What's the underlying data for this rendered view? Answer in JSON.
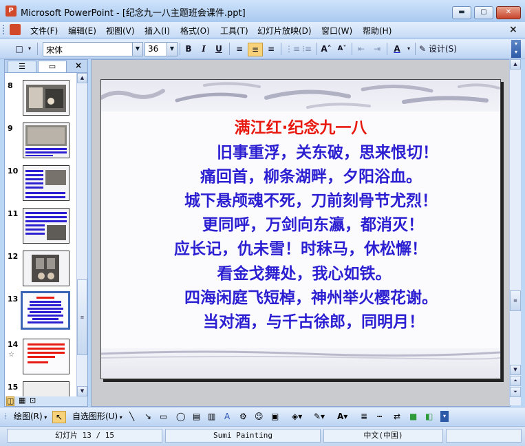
{
  "window": {
    "title": "Microsoft PowerPoint - [纪念九一八主题班会课件.ppt]",
    "app_icon": "powerpoint-icon",
    "min": "▬",
    "max": "▢",
    "close": "✕"
  },
  "menu": [
    "文件(F)",
    "编辑(E)",
    "视图(V)",
    "插入(I)",
    "格式(O)",
    "工具(T)",
    "幻灯片放映(D)",
    "窗口(W)",
    "帮助(H)"
  ],
  "menu_close": "×",
  "toolbar": {
    "font_name": "宋体",
    "font_size": "36",
    "bold": "B",
    "italic": "I",
    "underline": "U",
    "design_label": "设计(S)"
  },
  "thumbnails": [
    {
      "num": "8",
      "selected": false
    },
    {
      "num": "9",
      "selected": false
    },
    {
      "num": "10",
      "selected": false
    },
    {
      "num": "11",
      "selected": false
    },
    {
      "num": "12",
      "selected": false
    },
    {
      "num": "13",
      "selected": true
    },
    {
      "num": "14",
      "selected": false
    },
    {
      "num": "15",
      "selected": false
    }
  ],
  "slide": {
    "title": "满江红·纪念九一八",
    "title_color": "#e8190f",
    "text_color": "#2b1fd1",
    "lines": [
      "旧事重浮，关东破，思来恨切！",
      "痛回首，柳条湖畔，夕阳浴血。",
      "城下悬颅魂不死，刀前刻骨节尤烈！",
      "更同呼，万剑向东瀛，都消灭！",
      "应长记，仇未雪！时秣马，休松懈！",
      "看金戈舞处，我心如铁。",
      "四海闲庭飞短棹，神州举火樱花谢。",
      "当对酒，与千古徐郎，同明月！"
    ]
  },
  "drawbar": {
    "draw_label": "绘图(R)",
    "autoshape_label": "自选图形(U)"
  },
  "status": {
    "slide_info": "幻灯片 13 / 15",
    "template": "Sumi Painting",
    "language": "中文(中国)"
  }
}
